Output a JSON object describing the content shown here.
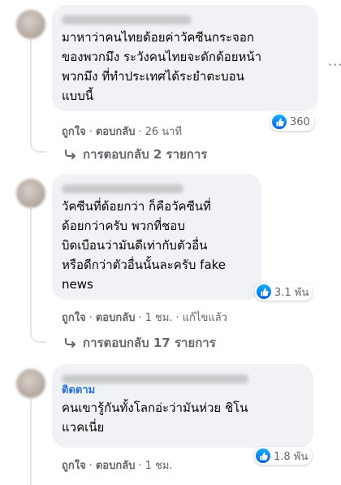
{
  "comments": [
    {
      "author_hidden": true,
      "text_lines": [
        "มาหาว่าคนไทยด้อยค่าวัคซีนกระจอก",
        "ของพวกมึง ระวังคนไทยจะดักด้อยหน้า",
        "พวกมึง ที่ทำประเทศได้ระยำตะบอน",
        "แบบนี้"
      ],
      "reaction_count": "360",
      "like_label": "ถูกใจ",
      "reply_label": "ตอบกลับ",
      "time": "26 นาที",
      "replies_label": "การตอบกลับ 2 รายการ"
    },
    {
      "author_hidden": true,
      "text_lines": [
        "วัคซีนที่ด้อยกว่า ก็คือวัคซีนที่",
        "ด้อยกว่าครับ พวกที่ชอบ",
        "บิดเบือนว่ามันดีเท่ากับตัวอื่น",
        "หรือดีกว่าตัวอื่นนั้นละครับ fake",
        "news"
      ],
      "reaction_count": "3.1 พัน",
      "like_label": "ถูกใจ",
      "reply_label": "ตอบกลับ",
      "time": "1 ชม.",
      "edited_label": "แก้ไขแล้ว",
      "replies_label": "การตอบกลับ 17 รายการ"
    },
    {
      "author_hidden": true,
      "follow_label": "ติดตาม",
      "text_lines": [
        "คนเขารู้กันทั้งโลกอ่ะว่ามันห่วย ชิโน",
        "แวคเนี่ย"
      ],
      "reaction_count": "1.8 พัน",
      "like_label": "ถูกใจ",
      "reply_label": "ตอบกลับ",
      "time": "1 ชม."
    }
  ],
  "colors": {
    "bubble": "#f0f2f5",
    "meta": "#65676b",
    "like_blue": "#1877f2",
    "follow": "#216fdb"
  },
  "icons": {
    "reaction": "like-thumb-icon",
    "more": "more-horizontal-icon",
    "reply_arrow": "reply-arrow-icon"
  }
}
